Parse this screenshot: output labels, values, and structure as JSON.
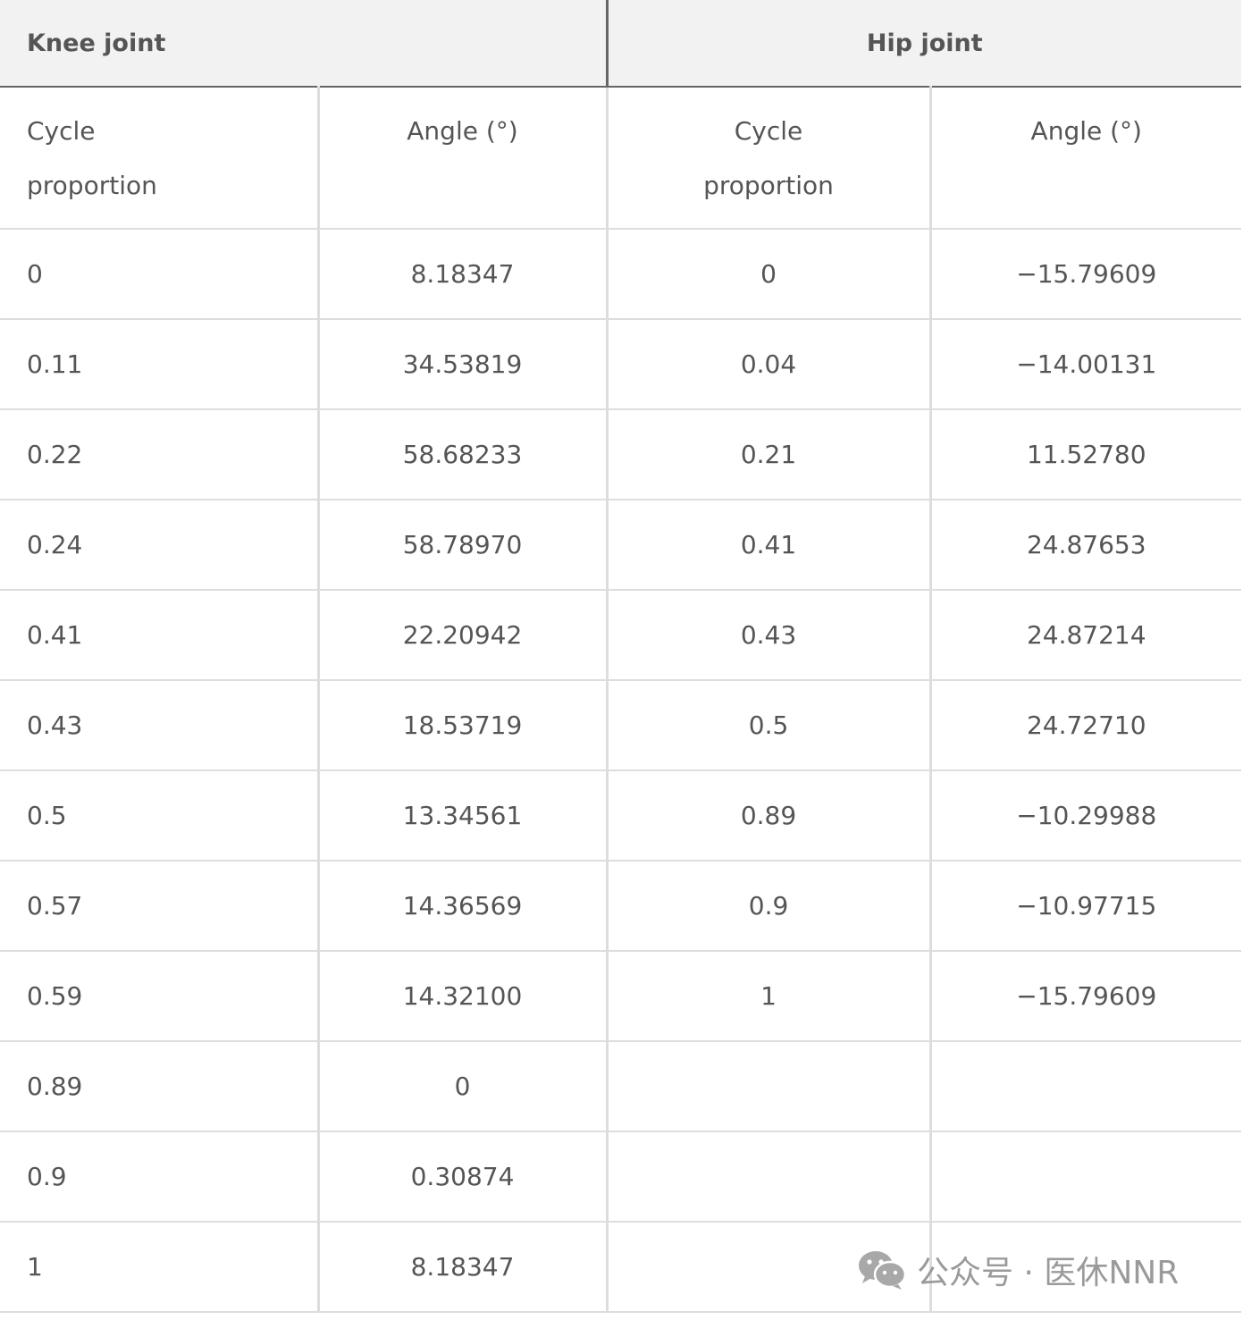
{
  "table": {
    "groups": [
      {
        "label": "Knee joint"
      },
      {
        "label": "Hip joint"
      }
    ],
    "subheaders": [
      {
        "line1": "Cycle",
        "line2": "proportion"
      },
      {
        "line1": "Angle (°)",
        "line2": ""
      },
      {
        "line1": "Cycle",
        "line2": "proportion"
      },
      {
        "line1": "Angle (°)",
        "line2": ""
      }
    ],
    "rows": [
      [
        "0",
        "8.18347",
        "0",
        "−15.79609"
      ],
      [
        "0.11",
        "34.53819",
        "0.04",
        "−14.00131"
      ],
      [
        "0.22",
        "58.68233",
        "0.21",
        "11.52780"
      ],
      [
        "0.24",
        "58.78970",
        "0.41",
        "24.87653"
      ],
      [
        "0.41",
        "22.20942",
        "0.43",
        "24.87214"
      ],
      [
        "0.43",
        "18.53719",
        "0.5",
        "24.72710"
      ],
      [
        "0.5",
        "13.34561",
        "0.89",
        "−10.29988"
      ],
      [
        "0.57",
        "14.36569",
        "0.9",
        "−10.97715"
      ],
      [
        "0.59",
        "14.32100",
        "1",
        "−15.79609"
      ],
      [
        "0.89",
        "0",
        "",
        ""
      ],
      [
        "0.9",
        "0.30874",
        "",
        ""
      ],
      [
        "1",
        "8.18347",
        "",
        ""
      ]
    ]
  },
  "watermark": {
    "icon": "wechat-icon",
    "text": "公众号 · 医休NNR"
  }
}
